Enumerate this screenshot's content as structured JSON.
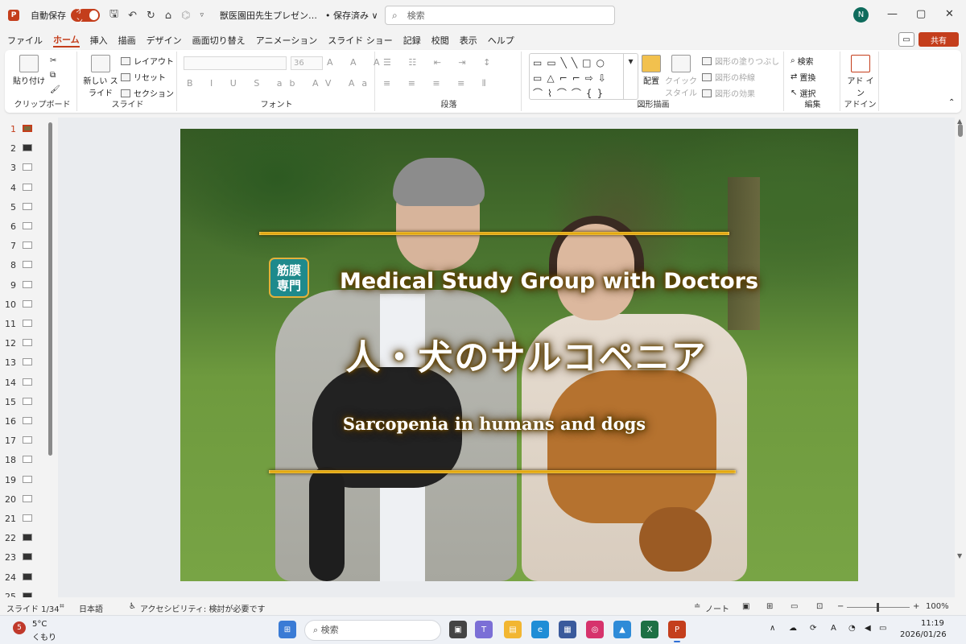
{
  "titlebar": {
    "app_icon": "P",
    "autosave_label": "自動保存",
    "autosave_toggle": "オン",
    "doc_title": "獣医園田先生プレゼン…",
    "saved_state": "• 保存済み ∨",
    "search_placeholder": "検索",
    "avatar_initial": "N",
    "minimize": "—",
    "restore": "▢",
    "close": "✕"
  },
  "menu": {
    "tabs": [
      "ファイル",
      "ホーム",
      "挿入",
      "描画",
      "デザイン",
      "画面切り替え",
      "アニメーション",
      "スライド ショー",
      "記録",
      "校閲",
      "表示",
      "ヘルプ"
    ],
    "active_tab": "ホーム",
    "comment_icon": "▭",
    "share_label": "共有"
  },
  "ribbon": {
    "clipboard": {
      "paste": "貼り付け",
      "label": "クリップボード"
    },
    "slides": {
      "new_slide": "新しい スライド",
      "layout": "レイアウト",
      "reset": "リセット",
      "section": "セクション",
      "label": "スライド"
    },
    "font": {
      "size": "36",
      "label": "フォント",
      "format_row": "B I U S ab AV Aa",
      "grow_row": "A A A"
    },
    "paragraph": {
      "label": "段落"
    },
    "drawing": {
      "arrange": "配置",
      "quick_style": "クイック スタイル",
      "fill": "図形の塗りつぶし",
      "outline": "図形の枠線",
      "effects": "図形の効果",
      "label": "図形描画"
    },
    "editing": {
      "find": "検索",
      "replace": "置換",
      "select": "選択",
      "label": "編集"
    },
    "addins": {
      "addin": "アド イン",
      "label": "アドイン"
    }
  },
  "slide_panel": {
    "numbers": [
      "1",
      "2",
      "3",
      "4",
      "5",
      "6",
      "7",
      "8",
      "9",
      "10",
      "11",
      "12",
      "13",
      "14",
      "15",
      "16",
      "17",
      "18",
      "19",
      "20",
      "21",
      "22",
      "23",
      "24",
      "25"
    ],
    "active": "1"
  },
  "slide": {
    "badge": "筋膜 専門",
    "subtitle_en": "Medical Study Group with Doctors",
    "title_jp": "人・犬のサルコペニア",
    "caption_en": "Sarcopenia in humans and dogs",
    "accent_gold": "#e0a000",
    "badge_teal": "#1e8a8c"
  },
  "status": {
    "slide_count": "スライド 1/34",
    "language": "日本語",
    "accessibility": "アクセシビリティ: 検討が必要です",
    "notes": "ノート",
    "zoom": "100%"
  },
  "taskbar": {
    "weather_badge": "5",
    "temperature": "5°C",
    "condition": "くもり",
    "search": "検索",
    "time": "11:19",
    "date": "2026/01/26"
  },
  "colors": {
    "accent": "#c43e1c"
  }
}
